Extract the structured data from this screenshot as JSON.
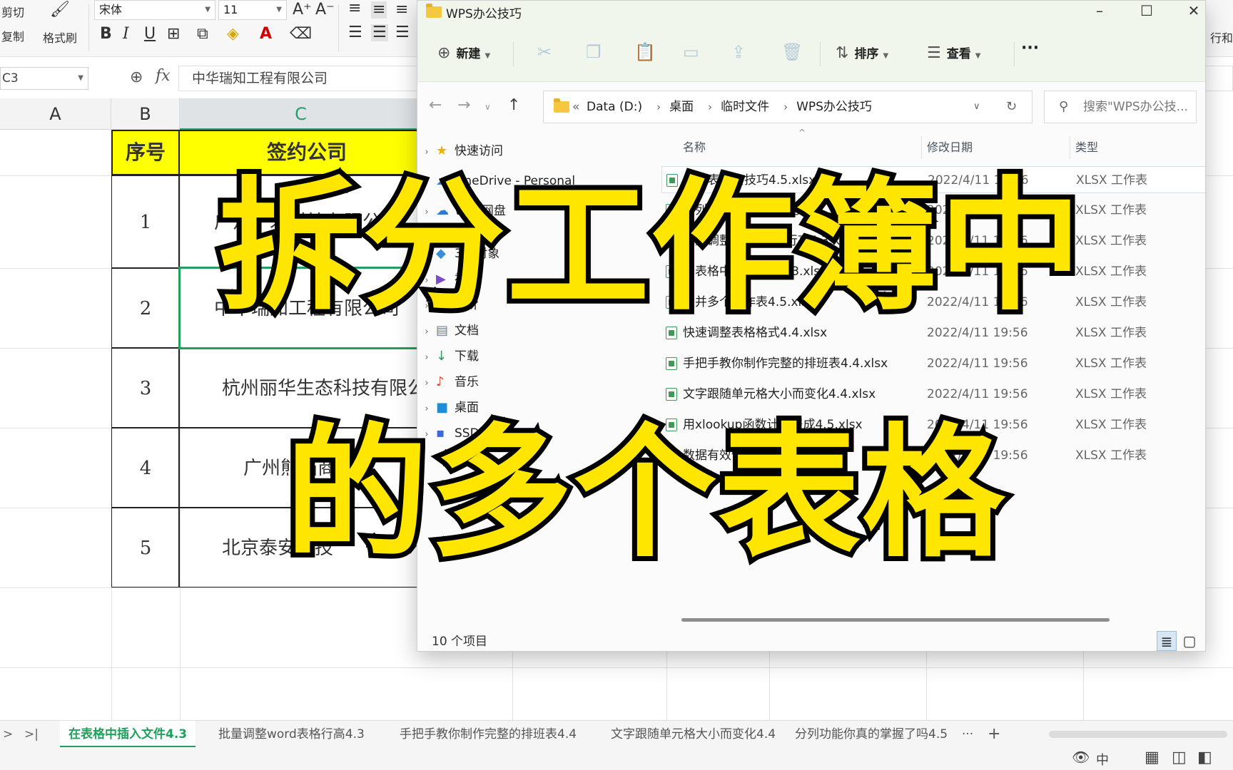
{
  "spreadsheet": {
    "ribbon": {
      "cut": "剪切",
      "copy": "复制",
      "format_painter": "格式刷",
      "font_name": "宋体",
      "font_size": "11",
      "bold": "B",
      "italic": "I",
      "underline": "U",
      "right_cut_label": "行和"
    },
    "name_box": "C3",
    "fx_label": "fx",
    "formula_value": "中华瑞知工程有限公司",
    "columns": [
      "A",
      "B",
      "C"
    ],
    "table": {
      "headers": [
        "序号",
        "签约公司"
      ],
      "rows": [
        {
          "no": "1",
          "company": "广州千禾科技有限公司"
        },
        {
          "no": "2",
          "company": "中华瑞知工程有限公司"
        },
        {
          "no": "3",
          "company": "杭州丽华生态科技有限公司"
        },
        {
          "no": "4",
          "company": "广州熊猫商贸"
        },
        {
          "no": "5",
          "company": "北京泰安科技"
        }
      ]
    },
    "sheet_tabs": [
      "在表格中插入文件4.3",
      "批量调整word表格行高4.3",
      "手把手教你制作完整的排班表4.4",
      "文字跟随单元格大小而变化4.4",
      "分列功能你真的掌握了吗4.5"
    ],
    "more_tabs": "···",
    "add_tab": "+",
    "status_input_mode": "中"
  },
  "explorer": {
    "title": "WPS办公技巧",
    "toolbar": {
      "new": "新建",
      "sort": "排序",
      "view": "查看",
      "more": "···"
    },
    "address": {
      "overflow": "«",
      "segments": [
        "Data (D:)",
        "桌面",
        "临时文件",
        "WPS办公技巧"
      ]
    },
    "search_placeholder": "搜索\"WPS办公技...",
    "nav": {
      "quick_access": "快速访问",
      "onedrive": "OneDrive - Personal",
      "wps": "WPS网盘",
      "this_pc_3d": "3D 对象",
      "videos": "视频",
      "pictures": "图片",
      "documents": "文档",
      "downloads": "下载",
      "music": "音乐",
      "desktop": "桌面",
      "ssd": "SSD (C:)"
    },
    "columns": {
      "name": "名称",
      "date": "修改日期",
      "type": "类型"
    },
    "files": [
      {
        "name": "超级表必会技巧4.5.xlsx",
        "date": "2022/4/11 19:56",
        "type": "XLSX 工作表"
      },
      {
        "name": "分列功能你真的掌握了吗4.5.xlsx",
        "date": "2022/4/11 19:56",
        "type": "XLSX 工作表"
      },
      {
        "name": "批量调整word表格行高4.3.xlsx",
        "date": "2022/4/11 19:56",
        "type": "XLSX 工作表"
      },
      {
        "name": "在表格中插入文件4.3.xlsx",
        "date": "2022/4/11 19:56",
        "type": "XLSX 工作表"
      },
      {
        "name": "合并多个工作表4.5.xlsx",
        "date": "2022/4/11 19:56",
        "type": "XLSX 工作表"
      },
      {
        "name": "快速调整表格格式4.4.xlsx",
        "date": "2022/4/11 19:56",
        "type": "XLSX 工作表"
      },
      {
        "name": "手把手教你制作完整的排班表4.4.xlsx",
        "date": "2022/4/11 19:56",
        "type": "XLSX 工作表"
      },
      {
        "name": "文字跟随单元格大小而变化4.4.xlsx",
        "date": "2022/4/11 19:56",
        "type": "XLSX 工作表"
      },
      {
        "name": "用xlookup函数计算提成4.5.xlsx",
        "date": "2022/4/11 19:56",
        "type": "XLSX 工作表"
      },
      {
        "name": "数据有效性设置4.5.xlsx",
        "date": "2022/4/11 19:56",
        "type": "XLSX 工作表"
      }
    ],
    "item_count": "10 个项目"
  },
  "caption": {
    "line1": "拆分工作簿中",
    "line2": "的多个表格",
    "fill_color": "#ffe600",
    "stroke_color": "#000000"
  }
}
